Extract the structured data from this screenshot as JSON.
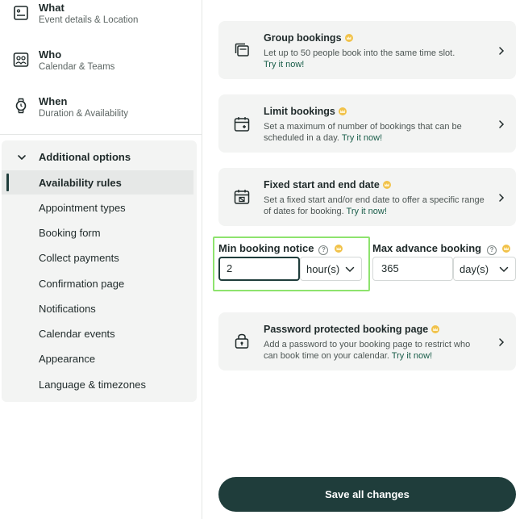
{
  "sidebar": {
    "sections": [
      {
        "title": "What",
        "subtitle": "Event details & Location",
        "icon": "list-icon"
      },
      {
        "title": "Who",
        "subtitle": "Calendar & Teams",
        "icon": "people-icon"
      },
      {
        "title": "When",
        "subtitle": "Duration & Availability",
        "icon": "watch-icon"
      }
    ],
    "options_title": "Additional options",
    "items": [
      {
        "label": "Availability rules",
        "active": true
      },
      {
        "label": "Appointment types"
      },
      {
        "label": "Booking form"
      },
      {
        "label": "Collect payments"
      },
      {
        "label": "Confirmation page"
      },
      {
        "label": "Notifications"
      },
      {
        "label": "Calendar events"
      },
      {
        "label": "Appearance"
      },
      {
        "label": "Language & timezones"
      }
    ]
  },
  "main": {
    "cards": [
      {
        "title": "Group bookings",
        "desc": "Let up to 50 people book into the same time slot.",
        "link": "Try it now!",
        "icon": "stack-icon"
      },
      {
        "title": "Limit bookings",
        "desc": "Set a maximum of number of bookings that can be scheduled in a day.",
        "link": "Try it now!",
        "icon": "calendar-plus-icon"
      },
      {
        "title": "Fixed start and end date",
        "desc": "Set a fixed start and/or end date to offer a specific range of dates for booking.",
        "link": "Try it now!",
        "icon": "calendar-range-icon"
      },
      {
        "title": "Password protected booking page",
        "desc": "Add a password to your booking page to restrict who can book time on your calendar.",
        "link": "Try it now!",
        "icon": "lock-icon"
      }
    ],
    "min_notice": {
      "label": "Min booking notice",
      "value": "2",
      "unit": "hour(s)"
    },
    "max_advance": {
      "label": "Max advance booking",
      "value": "365",
      "unit": "day(s)"
    },
    "help_glyph": "?",
    "save_label": "Save all changes"
  },
  "colors": {
    "accent": "#1f3d3b",
    "highlight": "#8ee36e",
    "crown": "#f1c24a",
    "link": "#1a5e4a"
  }
}
